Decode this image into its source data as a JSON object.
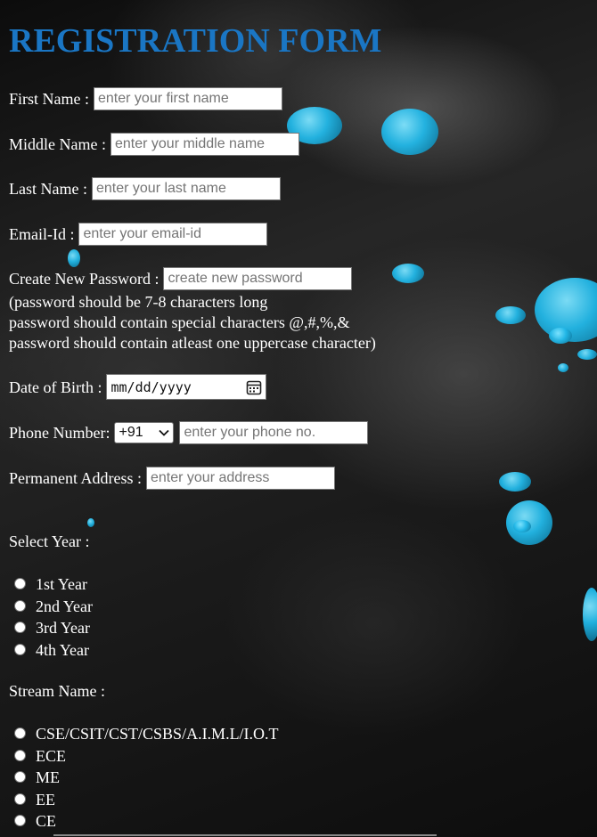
{
  "form": {
    "title": "REGISTRATION FORM",
    "first_name": {
      "label": "First Name :",
      "placeholder": "enter your first name"
    },
    "middle_name": {
      "label": "Middle Name :",
      "placeholder": "enter your middle name"
    },
    "last_name": {
      "label": "Last Name :",
      "placeholder": "enter your last name"
    },
    "email": {
      "label": "Email-Id :",
      "placeholder": "enter your email-id"
    },
    "password": {
      "label": "Create New Password :",
      "placeholder": "create new password",
      "rules": [
        "(password should be 7-8 characters long",
        "password should contain special characters @,#,%,&",
        "password should contain atleast one uppercase character)"
      ]
    },
    "dob": {
      "label": "Date of Birth :",
      "value": "mm/dd/yyyy"
    },
    "phone": {
      "label": "Phone Number:",
      "country_code": "+91",
      "placeholder": "enter your phone no."
    },
    "address": {
      "label": "Permanent Address :",
      "placeholder": "enter your address"
    },
    "year": {
      "label": "Select Year :",
      "options": [
        "1st Year",
        "2nd Year",
        "3rd Year",
        "4th Year"
      ]
    },
    "stream": {
      "label": "Stream Name :",
      "options": [
        "CSE/CSIT/CST/CSBS/A.I.M.L/I.O.T",
        "ECE",
        "ME",
        "EE",
        "CE"
      ]
    }
  },
  "theme": {
    "title_color": "#1a76c4",
    "accent_drop_color": "#22b8e8",
    "text_color": "#ffffff"
  },
  "icons": {
    "date_picker": "calendar-icon",
    "select": "chevron-down-icon"
  }
}
